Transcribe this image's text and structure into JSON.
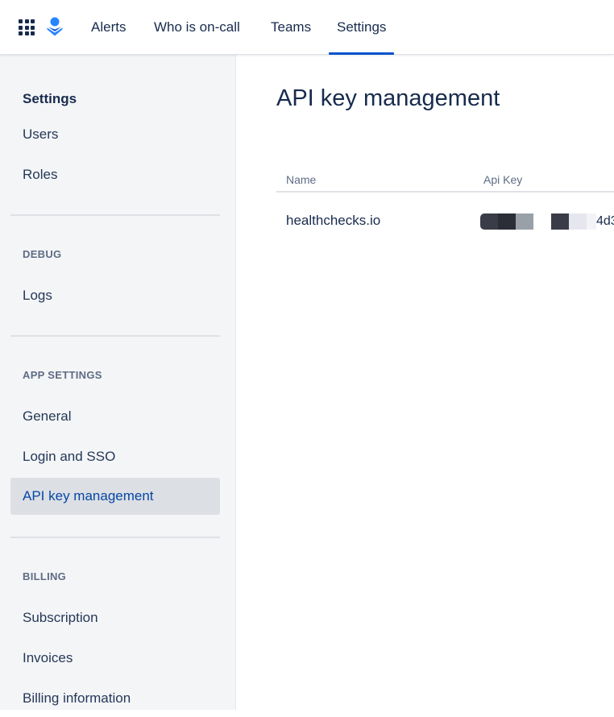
{
  "topnav": {
    "items": [
      {
        "label": "Alerts"
      },
      {
        "label": "Who is on-call"
      },
      {
        "label": "Teams"
      },
      {
        "label": "Settings"
      }
    ],
    "active": "Settings",
    "accent": "#0052cc"
  },
  "sidebar": {
    "heading": "Settings",
    "top_items": [
      {
        "label": "Users"
      },
      {
        "label": "Roles"
      }
    ],
    "groups": [
      {
        "title": "DEBUG",
        "items": [
          {
            "label": "Logs"
          }
        ]
      },
      {
        "title": "APP SETTINGS",
        "items": [
          {
            "label": "General"
          },
          {
            "label": "Login and SSO"
          },
          {
            "label": "API key management"
          }
        ]
      },
      {
        "title": "BILLING",
        "items": [
          {
            "label": "Subscription"
          },
          {
            "label": "Invoices"
          },
          {
            "label": "Billing information"
          }
        ]
      }
    ],
    "selected": "API key management"
  },
  "main": {
    "title": "API key management",
    "table": {
      "columns": [
        "Name",
        "Api Key"
      ],
      "rows": [
        {
          "name": "healthchecks.io",
          "api_key_visible": "4d3"
        }
      ]
    }
  }
}
